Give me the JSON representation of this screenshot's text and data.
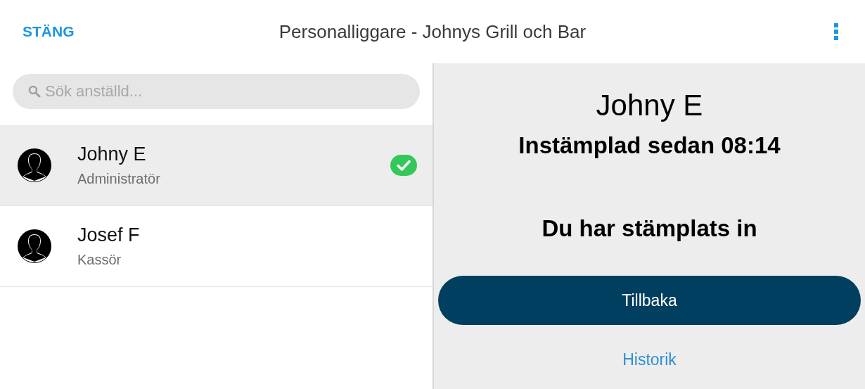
{
  "header": {
    "close_label": "STÄNG",
    "title": "Personalliggare - Johnys Grill och Bar"
  },
  "search": {
    "placeholder": "Sök anställd..."
  },
  "employees": [
    {
      "name": "Johny E",
      "role": "Administratör",
      "selected": true,
      "checked_in": true
    },
    {
      "name": "Josef F",
      "role": "Kassör",
      "selected": false,
      "checked_in": false
    }
  ],
  "detail": {
    "name": "Johny E",
    "status": "Instämplad sedan 08:14",
    "message": "Du har stämplats in",
    "primary_button": "Tillbaka",
    "link": "Historik"
  }
}
